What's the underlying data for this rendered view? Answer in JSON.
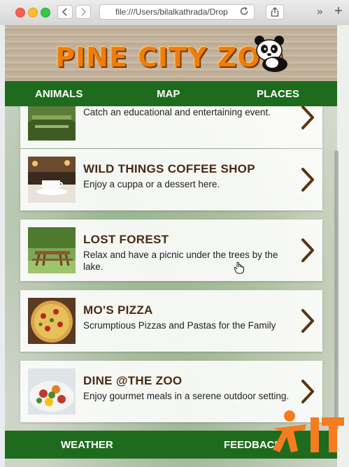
{
  "browser": {
    "address": "file:///Users/bilalkathrada/Drop",
    "more_label": "»",
    "new_tab_label": "+"
  },
  "header": {
    "logo_text": "PINE CITY ZOO"
  },
  "top_nav": [
    "ANIMALS",
    "MAP",
    "PLACES"
  ],
  "places": [
    {
      "title": "",
      "description": "Catch an educational and entertaining event.",
      "thumb": "event-crowd"
    },
    {
      "title": "WILD THINGS COFFEE SHOP",
      "description": "Enjoy a cuppa or a dessert here.",
      "thumb": "coffee-cup"
    },
    {
      "title": "LOST FOREST",
      "description": "Relax and have a picnic under the trees by the lake.",
      "thumb": "picnic-table"
    },
    {
      "title": "MO'S PIZZA",
      "description": "Scrumptious Pizzas and Pastas for the Family",
      "thumb": "pizza"
    },
    {
      "title": "DINE @THE ZOO",
      "description": "Enjoy gourmet meals in a serene outdoor setting.",
      "thumb": "salad"
    }
  ],
  "bottom_nav": {
    "weather": "WEATHER",
    "feedback": "FEEDBACK"
  },
  "colors": {
    "nav_green": "#1e6b1e",
    "logo_orange": "#f07d0a",
    "title_brown": "#4a2a12",
    "chevron_brown": "#5a3410"
  }
}
